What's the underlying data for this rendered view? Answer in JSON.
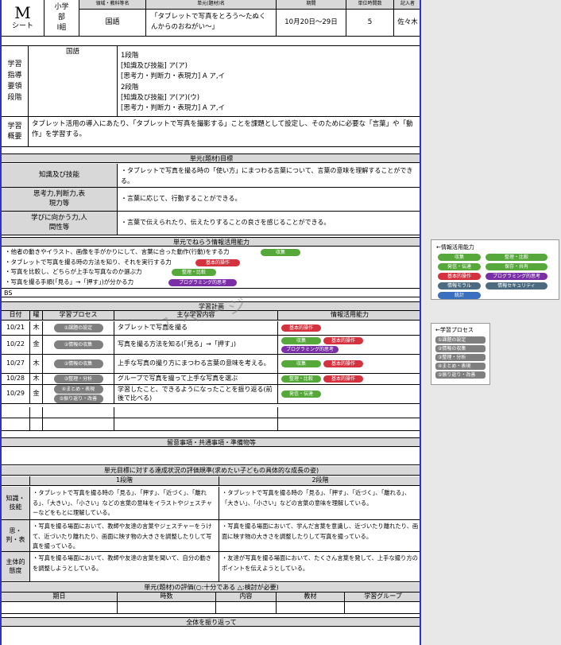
{
  "header": {
    "sheet_letter": "M",
    "sheet_label": "シート",
    "school_lines": [
      "小学",
      "部",
      "Ⅰ組"
    ],
    "subject_label": "領域・教科等名",
    "subject": "国語",
    "unit_label": "単元(題材)名",
    "unit": "「タブレットで写真をとろう～たぬくんからのおねがい～」",
    "period_label": "期間",
    "period": "10月20日～29日",
    "hours_label": "単位時間数",
    "hours": "5",
    "author_label": "記入者",
    "author": "佐々木"
  },
  "guidance": {
    "label": "学習指導要領段階",
    "subject": "国語",
    "lines": [
      "1段階",
      "[知識及び技能] ア(ア)",
      "[思考力・判断力・表現力] A ア,イ",
      "2段階",
      "[知識及び技能] ア(ア)(ウ)",
      "[思考力・判断力・表現力] A ア,イ"
    ]
  },
  "overview": {
    "label": "学習概要",
    "text": "タブレット活用の導入にあたり、「タブレットで写真を撮影する」ことを課題として設定し、そのために必要な「言葉」や「動作」を学習する。"
  },
  "goals": {
    "title": "単元(題材)目標",
    "rows": [
      {
        "label": "知識及び技能",
        "text": "・タブレットで写真を撮る時の「使い方」にまつわる言葉について、言葉の意味を理解することができる。"
      },
      {
        "label": "思考力,判断力,表現力等",
        "text": "・言葉に応じて、行動することができる。"
      },
      {
        "label": "学びに向かう力,人間性等",
        "text": "・言葉で伝えられたり、伝えたりすることの良さを感じることができる。"
      }
    ]
  },
  "aims": {
    "title": "単元でねらう情報活用能力",
    "items": [
      {
        "text": "・他者の動きやイラスト、画像を手がかりにして、言葉に合った動作(行動)をする力",
        "tag": "収集",
        "color": "green"
      },
      {
        "text": "・タブレットで写真を撮る時の方法を知り、それを実行する力",
        "tag": "基本的操作",
        "color": "red"
      },
      {
        "text": "・写真を比較し、どちらが上手な写真なのか選ぶ力",
        "tag": "整理・比較",
        "color": "green"
      },
      {
        "text": "・写真を撮る手順(「見る」→「押す」)が分かる力",
        "tag": "プログラミング的思考",
        "color": "purple"
      }
    ],
    "bs": "BS"
  },
  "plan": {
    "title": "学習計画",
    "headers": [
      "日付",
      "曜",
      "学習プロセス",
      "主な学習内容",
      "情報活用能力"
    ],
    "watermark": "１ページ",
    "rows": [
      {
        "date": "10/21",
        "day": "木",
        "process": [
          "①課題の設定"
        ],
        "content": "タブレットで写真を撮る",
        "tags": [
          {
            "t": "基本的操作",
            "c": "red"
          }
        ]
      },
      {
        "date": "10/22",
        "day": "金",
        "process": [
          "②情報の収集"
        ],
        "content": "写真を撮る方法を知る(「見る」→「押す」)",
        "tags": [
          {
            "t": "収集",
            "c": "green"
          },
          {
            "t": "基本的操作",
            "c": "red"
          },
          {
            "t": "プログラミング的思考",
            "c": "purple"
          }
        ]
      },
      {
        "date": "10/27",
        "day": "木",
        "process": [
          "②情報の収集"
        ],
        "content": "上手な写真の撮り方にまつわる言葉の意味を考える。",
        "tags": [
          {
            "t": "収集",
            "c": "green"
          },
          {
            "t": "基本的操作",
            "c": "red"
          }
        ]
      },
      {
        "date": "10/28",
        "day": "木",
        "process": [
          "③整理・分析"
        ],
        "content": "グループで写真を撮って上手な写真を選ぶ",
        "tags": [
          {
            "t": "整理・比較",
            "c": "green"
          },
          {
            "t": "基本的操作",
            "c": "red"
          }
        ]
      },
      {
        "date": "10/29",
        "day": "金",
        "process": [
          "④まとめ・表現",
          "⑤振り返り・改善"
        ],
        "content": "学習したこと、できるようになったことを振り返る(前後で比べる)",
        "tags": [
          {
            "t": "発信・伝達",
            "c": "green"
          }
        ]
      }
    ]
  },
  "notes": {
    "title": "留意事項・共通事項・準備物等"
  },
  "evaluation": {
    "title": "単元目標に対する達成状況の評価規準(求めたい子どもの具体的な成長の姿)",
    "col1": "1段階",
    "col2": "2段階",
    "rows": [
      {
        "label": "知識・技能",
        "s1": "・タブレットで写真を撮る時の「見る」、「押す」、「近づく」、「離れる」、「大きい」、「小さい」などの言葉の意味をイラストやジェスチャーなどをもとに理解している。",
        "s2": "・タブレットで写真を撮る時の「見る」、「押す」、「近づく」、「離れる」、「大きい」、「小さい」などの言葉の意味を理解している。"
      },
      {
        "label": "思・判・表",
        "s1": "・写真を撮る場面において、教師や友達の言葉やジェスチャーをうけて、近づいたり離れたり、画面に映す物の大きさを調整したりして写真を撮っている。",
        "s2": "・写真を撮る場面において、学んだ言葉を意識し、近づいたり離れたり、画面に映す物の大きさを調整したりして写真を撮っている。"
      },
      {
        "label": "主体的態度",
        "s1": "・写真を撮る場面において、教師や友達の言葉を聞いて、自分の動きを調整しようとしている。",
        "s2": "・友達が写真を撮る場面において、たくさん言葉を発して、上手な撮り方のポイントを伝えようとしている。"
      }
    ]
  },
  "assessment": {
    "title": "単元(題材)の評価(○:十分である △:検討が必要)",
    "headers": [
      "期日",
      "時数",
      "内容",
      "教材",
      "学習グループ"
    ]
  },
  "reflection": {
    "title": "全体を振り返って"
  },
  "legend_info": {
    "title": "←情報活用能力",
    "tags": [
      {
        "t": "収集",
        "c": "green"
      },
      {
        "t": "整理・比較",
        "c": "green"
      },
      {
        "t": "発信・伝達",
        "c": "green"
      },
      {
        "t": "保存・共有",
        "c": "green"
      },
      {
        "t": "基本的操作",
        "c": "red"
      },
      {
        "t": "プログラミング的思考",
        "c": "purple"
      },
      {
        "t": "情報モラル",
        "c": "slate"
      },
      {
        "t": "情報セキュリティ",
        "c": "slate"
      },
      {
        "t": "統計",
        "c": "blue"
      }
    ]
  },
  "legend_process": {
    "title": "←学習プロセス",
    "items": [
      "①課題の設定",
      "②情報の収集",
      "③整理・分析",
      "④まとめ・表現",
      "⑤振り返り・改善"
    ]
  }
}
